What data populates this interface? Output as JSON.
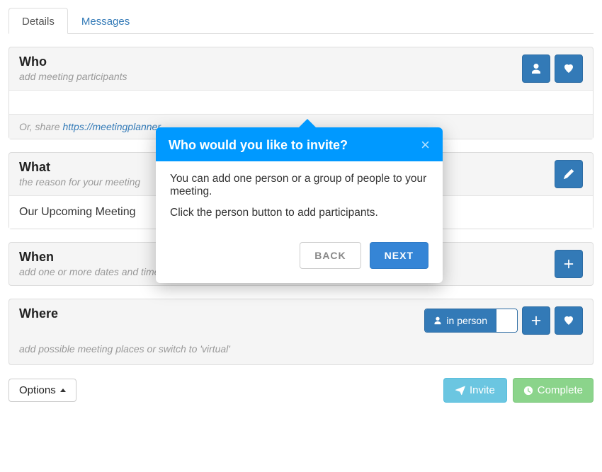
{
  "tabs": {
    "details": "Details",
    "messages": "Messages"
  },
  "who": {
    "title": "Who",
    "subtitle": "add meeting participants",
    "share_prefix": "Or, share ",
    "share_url": "https://meetingplanner..."
  },
  "what": {
    "title": "What",
    "subtitle": "the reason for your meeting",
    "value": "Our Upcoming Meeting"
  },
  "when": {
    "title": "When",
    "subtitle": "add one or more dates and times for participants to choose from"
  },
  "where": {
    "title": "Where",
    "subtitle": "add possible meeting places or switch to 'virtual'",
    "in_person": "in person"
  },
  "bottom": {
    "options": "Options",
    "invite": "Invite",
    "complete": "Complete"
  },
  "popover": {
    "title": "Who would you like to invite?",
    "p1": "You can add one person or a group of people to your meeting.",
    "p2": "Click the person button to add participants.",
    "back": "BACK",
    "next": "NEXT"
  }
}
